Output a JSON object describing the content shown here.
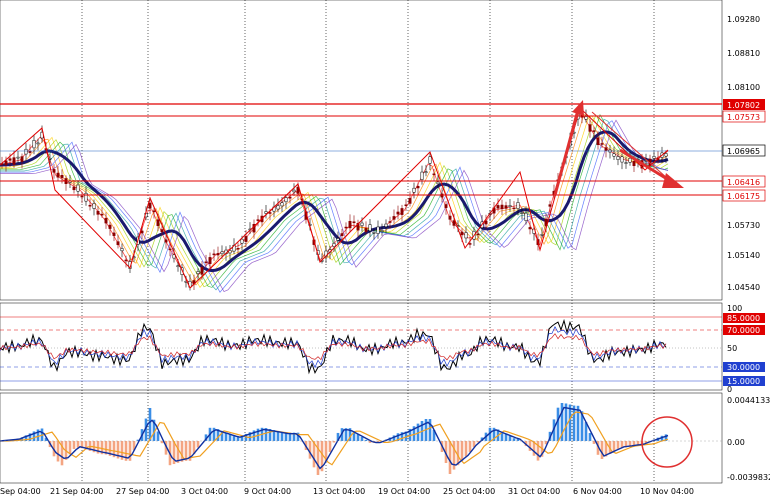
{
  "colors": {
    "background": "#ffffff",
    "grid": "#000000",
    "candle_up": "#000000",
    "candle_down": "#8b0000",
    "resistance": "#e00000",
    "current_price": "#2060c0",
    "ma_thick": "#1a1a6e",
    "zigzag": "#e00000",
    "macd_hist_pos": "#3a8ee6",
    "macd_hist_neg": "#f4a582",
    "macd_line": "#1030a0",
    "signal_line": "#f0a020",
    "annotation": "#e03030"
  },
  "main_panel": {
    "price_labels": [
      "1.09280",
      "1.08810",
      "1.08100",
      "1.07573",
      "1.06965",
      "1.06416",
      "1.06175",
      "1.05730",
      "1.05140",
      "1.04540"
    ],
    "level_tags": [
      {
        "id": "resistance-upper",
        "text": "1.07802",
        "color": "#e00000",
        "text_color": "#ffffff"
      },
      {
        "id": "resistance-lower",
        "text": "1.07573",
        "color": "#ffffff",
        "text_color": "#e00000"
      },
      {
        "id": "current-price",
        "text": "1.06965",
        "color": "#ffffff",
        "text_color": "#000000"
      },
      {
        "id": "support-upper",
        "text": "1.06416",
        "color": "#ffffff",
        "text_color": "#e00000"
      },
      {
        "id": "support-lower",
        "text": "1.06175",
        "color": "#ffffff",
        "text_color": "#e00000"
      }
    ]
  },
  "rsi_panel": {
    "labels": [
      "100",
      "85.0000",
      "70.0000",
      "50",
      "30.0000",
      "15.0000",
      "0"
    ]
  },
  "macd_panel": {
    "labels": [
      "0.0044133",
      "0.00",
      "-0.0039832"
    ]
  },
  "time_axis": {
    "labels": [
      "Sep 04:00",
      "21 Sep 04:00",
      "27 Sep 04:00",
      "3 Oct 04:00",
      "9 Oct 04:00",
      "13 Oct 04:00",
      "19 Oct 04:00",
      "25 Oct 04:00",
      "31 Oct 04:00",
      "6 Nov 04:00",
      "10 Nov 04:00"
    ]
  }
}
